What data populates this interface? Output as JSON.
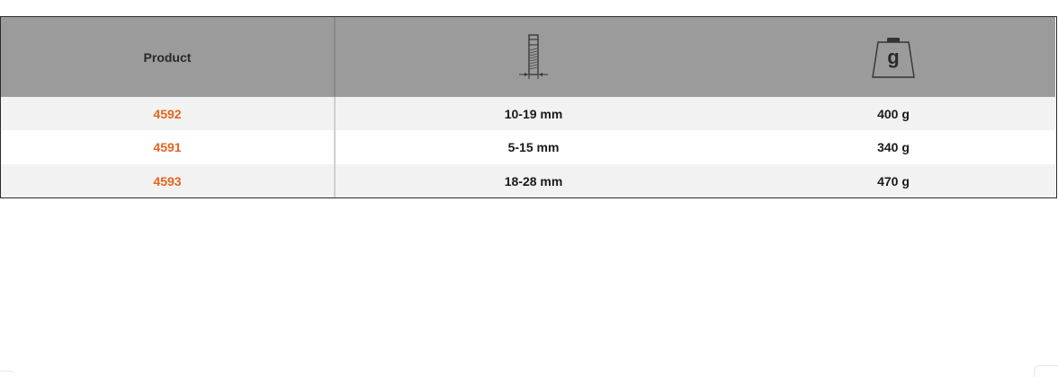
{
  "table": {
    "headers": {
      "product": "Product",
      "capacity_icon": "pipe-diameter-icon",
      "weight_icon": "weight-icon",
      "weight_icon_letter": "g"
    },
    "rows": [
      {
        "product": "4592",
        "capacity": "10-19 mm",
        "weight": "400 g"
      },
      {
        "product": "4591",
        "capacity": "5-15 mm",
        "weight": "340 g"
      },
      {
        "product": "4593",
        "capacity": "18-28 mm",
        "weight": "470 g"
      }
    ]
  },
  "colors": {
    "header_bg": "#9b9b9b",
    "product_link": "#e8641e",
    "row_alt": "#f2f2f2"
  }
}
